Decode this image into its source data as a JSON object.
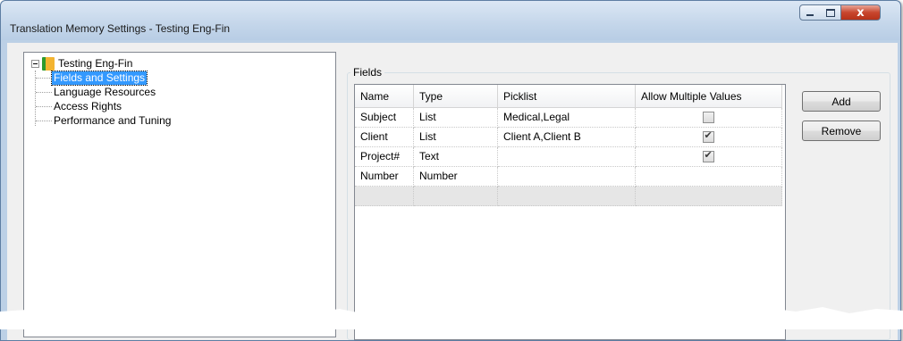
{
  "window": {
    "title": "Translation Memory Settings - Testing Eng-Fin",
    "controls": {
      "minimize": "minimize",
      "maximize": "maximize",
      "close": "close"
    }
  },
  "tree": {
    "root": {
      "label": "Testing Eng-Fin",
      "icon": "database-icon"
    },
    "items": [
      {
        "label": "Fields and Settings",
        "selected": true
      },
      {
        "label": "Language Resources"
      },
      {
        "label": "Access Rights"
      },
      {
        "label": "Performance and Tuning"
      }
    ]
  },
  "fields": {
    "group_label": "Fields",
    "columns": [
      "Name",
      "Type",
      "Picklist",
      "Allow Multiple Values"
    ],
    "rows": [
      {
        "name": "Subject",
        "type": "List",
        "picklist": "Medical,Legal",
        "allow_multiple": false
      },
      {
        "name": "Client",
        "type": "List",
        "picklist": "Client A,Client B",
        "allow_multiple": true
      },
      {
        "name": "Project#",
        "type": "Text",
        "picklist": "",
        "allow_multiple": true
      },
      {
        "name": "Number",
        "type": "Number",
        "picklist": "",
        "allow_multiple": null
      }
    ]
  },
  "buttons": {
    "add": "Add",
    "remove": "Remove"
  },
  "colors": {
    "selection": "#3399ff",
    "title_bar": "#c4d6ea",
    "close_button": "#c8462e"
  }
}
